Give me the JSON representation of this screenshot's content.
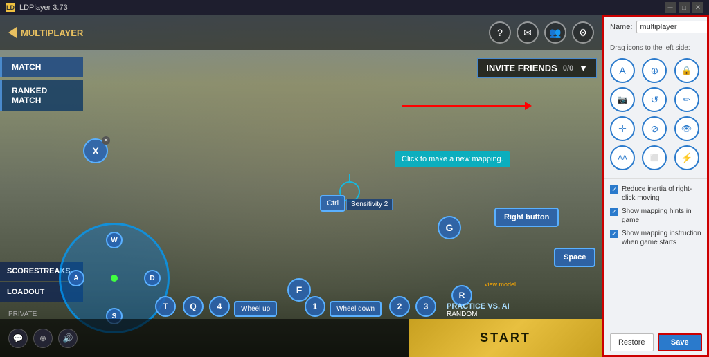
{
  "titleBar": {
    "title": "LDPlayer 3.73",
    "iconLabel": "LD"
  },
  "gameNav": {
    "backLabel": "MULTIPLAYER",
    "menuItems": [
      {
        "label": "MATCH",
        "active": true
      },
      {
        "label": "RANKED MATCH",
        "active": false
      }
    ],
    "bottomMenuItems": [
      {
        "label": "SCORESTREAKS"
      },
      {
        "label": "LOADOUT"
      }
    ]
  },
  "inviteBar": {
    "label": "InvITE FRIENDS",
    "count": "0/0"
  },
  "keyMappings": {
    "x": "X",
    "ctrl": "Ctrl",
    "sensitivity": "Sensitivity 2",
    "g": "G",
    "r": "R",
    "f": "F",
    "t": "T",
    "q": "Q",
    "four": "4",
    "wheelUp": "Wheel up",
    "one": "1",
    "wheelDown": "Wheel down",
    "two": "2",
    "three": "3",
    "rightButton": "Right button",
    "space": "Space",
    "wasd": {
      "w": "W",
      "a": "A",
      "s": "S",
      "d": "D"
    }
  },
  "tooltips": {
    "newMapping": "Click to make a new mapping."
  },
  "bottomBar": {
    "startLabel": "START",
    "privateLabel": "PRIVATE",
    "practiceLabel": "PRACTICE VS. AI",
    "randomLabel": "RANDOM",
    "viewModel": "view model"
  },
  "rightPanel": {
    "nameLabel": "Name:",
    "nameValue": "multiplayer",
    "dragHint": "Drag icons to the left side:",
    "icons": [
      {
        "name": "letter-a-icon",
        "symbol": "A"
      },
      {
        "name": "crosshair-icon",
        "symbol": "⊕"
      },
      {
        "name": "lock-icon",
        "symbol": "🔒"
      },
      {
        "name": "camera-icon",
        "symbol": "📷"
      },
      {
        "name": "reload-icon",
        "symbol": "↺"
      },
      {
        "name": "pencil-icon",
        "symbol": "✏"
      },
      {
        "name": "move-icon",
        "symbol": "✛"
      },
      {
        "name": "cancel-icon",
        "symbol": "⊘"
      },
      {
        "name": "eye-icon",
        "symbol": "👁"
      },
      {
        "name": "aa-icon",
        "symbol": "AA"
      },
      {
        "name": "screen-icon",
        "symbol": "⬜"
      },
      {
        "name": "lightning-icon",
        "symbol": "⚡"
      }
    ],
    "checkboxes": [
      {
        "label": "Reduce inertia of right-click moving",
        "checked": true
      },
      {
        "label": "Show mapping hints in game",
        "checked": true
      },
      {
        "label": "Show mapping instruction when game starts",
        "checked": true
      }
    ],
    "buttons": {
      "restore": "Restore",
      "save": "Save"
    }
  }
}
